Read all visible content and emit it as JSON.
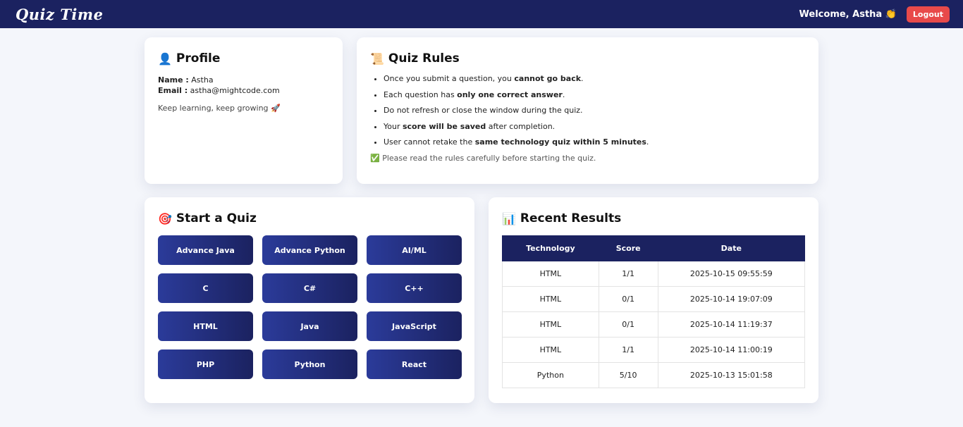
{
  "navbar": {
    "brand": "Quiz Time",
    "welcome": "Welcome, Astha 👏",
    "logout_label": "Logout"
  },
  "profile": {
    "icon": "👤",
    "title": "Profile",
    "name_label": "Name :",
    "name_value": "Astha",
    "email_label": "Email :",
    "email_value": "astha@mightcode.com",
    "tagline": "Keep learning, keep growing 🚀"
  },
  "rules": {
    "icon": "📜",
    "title": "Quiz Rules",
    "items": [
      {
        "pre": "Once you submit a question, you ",
        "bold": "cannot go back",
        "post": "."
      },
      {
        "pre": "Each question has ",
        "bold": "only one correct answer",
        "post": "."
      },
      {
        "pre": "Do not refresh or close the window during the quiz.",
        "bold": "",
        "post": ""
      },
      {
        "pre": "Your ",
        "bold": "score will be saved",
        "post": " after completion."
      },
      {
        "pre": "User cannot retake the ",
        "bold": "same technology quiz within 5 minutes",
        "post": "."
      }
    ],
    "note": "✅ Please read the rules carefully before starting the quiz."
  },
  "quiz": {
    "icon": "🎯",
    "title": "Start a Quiz",
    "buttons": [
      "Advance Java",
      "Advance Python",
      "AI/ML",
      "C",
      "C#",
      "C++",
      "HTML",
      "Java",
      "JavaScript",
      "PHP",
      "Python",
      "React"
    ]
  },
  "results": {
    "icon": "📊",
    "title": "Recent Results",
    "columns": [
      "Technology",
      "Score",
      "Date"
    ],
    "rows": [
      [
        "HTML",
        "1/1",
        "2025-10-15 09:55:59"
      ],
      [
        "HTML",
        "0/1",
        "2025-10-14 19:07:09"
      ],
      [
        "HTML",
        "0/1",
        "2025-10-14 11:19:37"
      ],
      [
        "HTML",
        "1/1",
        "2025-10-14 11:00:19"
      ],
      [
        "Python",
        "5/10",
        "2025-10-13 15:01:58"
      ]
    ]
  }
}
